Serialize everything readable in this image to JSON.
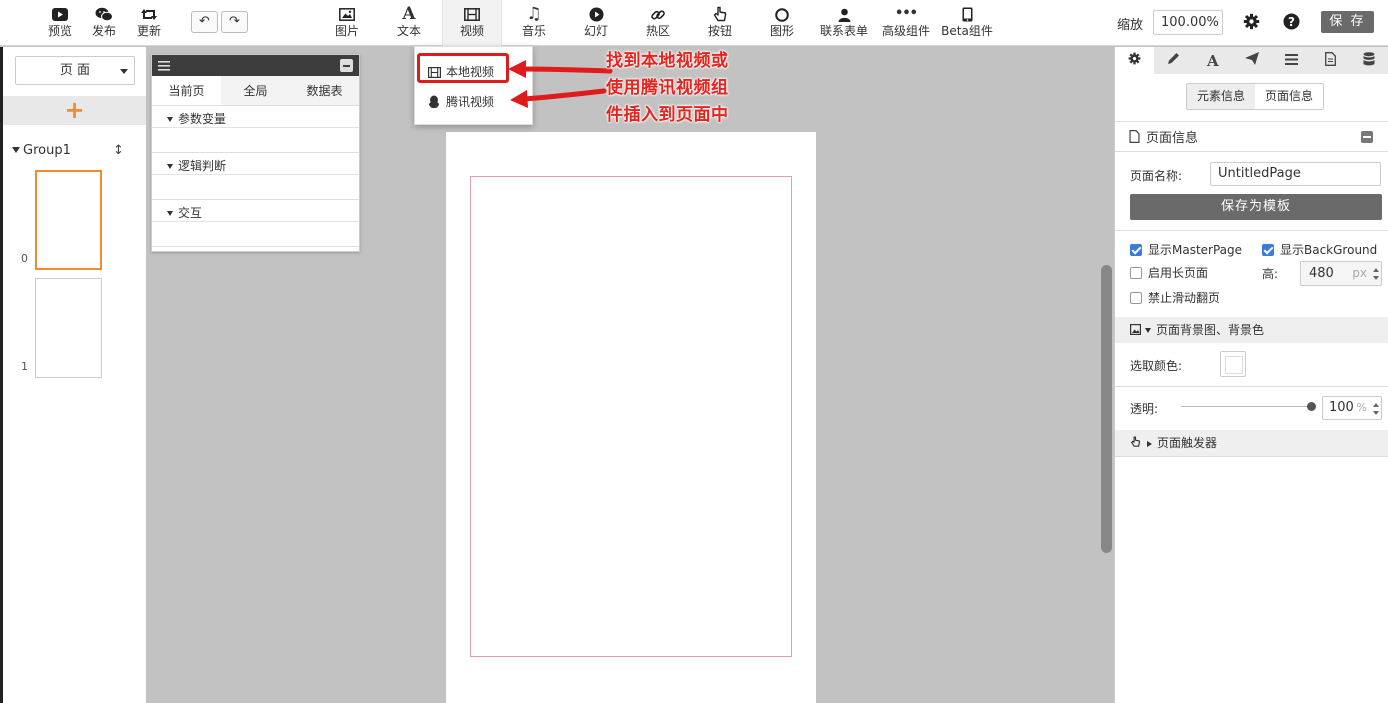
{
  "toolbar": {
    "left_items": [
      {
        "label": "预览",
        "icon": "youtube-icon"
      },
      {
        "label": "发布",
        "icon": "wechat-icon"
      },
      {
        "label": "更新",
        "icon": "retweet-icon"
      }
    ],
    "undo_icon": "undo-icon",
    "redo_icon": "redo-icon",
    "components": [
      {
        "label": "图片",
        "icon": "image-icon"
      },
      {
        "label": "文本",
        "icon": "font-icon"
      },
      {
        "label": "视频",
        "icon": "film-icon"
      },
      {
        "label": "音乐",
        "icon": "music-icon"
      },
      {
        "label": "幻灯",
        "icon": "play-circle-icon"
      },
      {
        "label": "热区",
        "icon": "link-icon"
      },
      {
        "label": "按钮",
        "icon": "hand-pointer-icon"
      },
      {
        "label": "图形",
        "icon": "circle-icon"
      },
      {
        "label": "联系表单",
        "icon": "user-icon"
      },
      {
        "label": "高级组件",
        "icon": "ellipsis-icon"
      },
      {
        "label": "Beta组件",
        "icon": "tablet-icon"
      }
    ],
    "zoom_label": "缩放",
    "zoom_value": "100.00%",
    "save_label": "保 存"
  },
  "video_menu": {
    "items": [
      {
        "label": "本地视频",
        "icon": "film-icon"
      },
      {
        "label": "腾讯视频",
        "icon": "qq-icon"
      }
    ]
  },
  "annotation": {
    "line1": "找到本地视频或",
    "line2": "使用腾讯视频组",
    "line3": "件插入到页面中",
    "color": "#e8231c"
  },
  "left_panel": {
    "page_select": "页 面",
    "add_symbol": "+",
    "group_label": "Group1",
    "thumbnails": [
      {
        "index": "0",
        "active": true
      },
      {
        "index": "1",
        "active": false
      }
    ]
  },
  "var_panel": {
    "tabs": [
      "当前页",
      "全局",
      "数据表"
    ],
    "sections": [
      "参数变量",
      "逻辑判断",
      "交互"
    ]
  },
  "right_panel": {
    "tabs": [
      "gear-icon",
      "pencil-icon",
      "font-icon",
      "paper-plane-icon",
      "list-icon",
      "file-icon",
      "database-icon"
    ],
    "toggle": [
      "元素信息",
      "页面信息"
    ],
    "section_title": "页面信息",
    "page_name_label": "页面名称:",
    "page_name_value": "UntitledPage",
    "save_template_label": "保存为模板",
    "show_master_page": "显示MasterPage",
    "show_background": "显示BackGround",
    "long_page": "启用长页面",
    "height_label": "高:",
    "height_value": "480",
    "height_unit": "px",
    "disable_swipe": "禁止滑动翻页",
    "bg_section": "页面背景图、背景色",
    "pick_color_label": "选取颜色:",
    "opacity_label": "透明:",
    "opacity_value": "100",
    "opacity_unit": "%",
    "trigger_section": "页面触发器"
  },
  "colors": {
    "accent_orange": "#f08c2e",
    "checkbox_blue": "#3a7be0",
    "highlight_red": "#e01b1b",
    "canvas_bg": "#c2c2c2"
  }
}
